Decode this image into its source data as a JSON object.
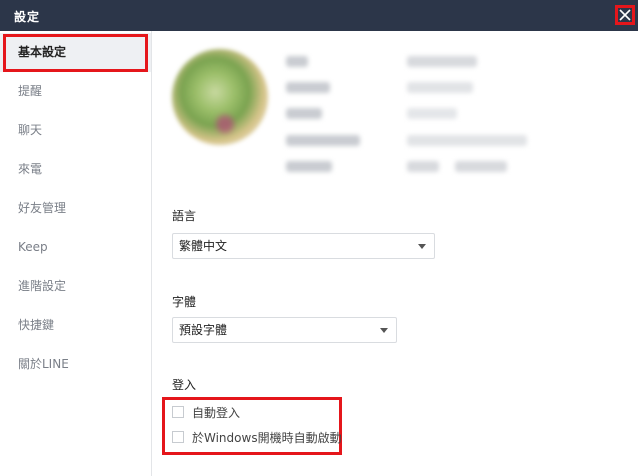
{
  "window": {
    "title": "設定"
  },
  "sidebar": {
    "items": [
      {
        "label": "基本設定",
        "active": true
      },
      {
        "label": "提醒"
      },
      {
        "label": "聊天"
      },
      {
        "label": "來電"
      },
      {
        "label": "好友管理"
      },
      {
        "label": "Keep"
      },
      {
        "label": "進階設定"
      },
      {
        "label": "快捷鍵"
      },
      {
        "label": "關於LINE"
      }
    ]
  },
  "language": {
    "heading": "語言",
    "selected": "繁體中文"
  },
  "font": {
    "heading": "字體",
    "selected": "預設字體"
  },
  "login": {
    "heading": "登入",
    "auto_login": {
      "label": "自動登入",
      "checked": false
    },
    "auto_start": {
      "label": "於Windows開機時自動啟動",
      "checked": false
    }
  },
  "colors": {
    "titlebar": "#2c3649",
    "highlight": "#e5161b",
    "active_bg": "#eef0f3"
  }
}
